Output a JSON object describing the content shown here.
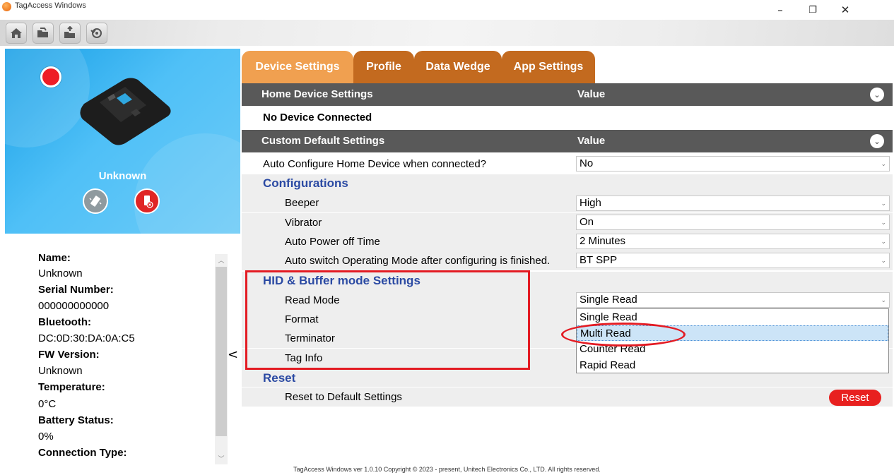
{
  "window": {
    "title": "TagAccess Windows",
    "minimize": "–",
    "restore": "❐",
    "close": "✕"
  },
  "toolbar": {
    "icons": [
      "home-icon",
      "open-folder-icon",
      "open-folder-arrow-icon",
      "refresh-icon"
    ]
  },
  "device": {
    "name": "Unknown",
    "status_color": "#ee1c25"
  },
  "info": {
    "name_label": "Name:",
    "name_value": "Unknown",
    "serial_label": "Serial Number:",
    "serial_value": "000000000000",
    "bt_label": "Bluetooth:",
    "bt_value": "DC:0D:30:DA:0A:C5",
    "fw_label": "FW Version:",
    "fw_value": "Unknown",
    "temp_label": "Temperature:",
    "temp_value": "0°C",
    "battery_label": "Battery Status:",
    "battery_value": "0%",
    "conn_label": "Connection Type:"
  },
  "collapse_arrow": "<",
  "tabs": [
    "Device Settings",
    "Profile",
    "Data Wedge",
    "App Settings"
  ],
  "home_header": {
    "label": "Home Device Settings",
    "value": "Value"
  },
  "no_device": "No Device Connected",
  "custom_header": {
    "label": "Custom Default Settings",
    "value": "Value"
  },
  "auto_configure": {
    "label": "Auto Configure Home Device when connected?",
    "value": "No"
  },
  "configurations": {
    "title": "Configurations",
    "beeper": {
      "label": "Beeper",
      "value": "High"
    },
    "vibrator": {
      "label": "Vibrator",
      "value": "On"
    },
    "power_off": {
      "label": "Auto Power off Time",
      "value": "2 Minutes"
    },
    "auto_switch": {
      "label": "Auto switch Operating Mode after configuring is finished.",
      "value": "BT SPP"
    }
  },
  "hid": {
    "title": "HID & Buffer mode Settings",
    "read_mode": {
      "label": "Read Mode",
      "value": "Single Read"
    },
    "format": "Format",
    "terminator": "Terminator",
    "tag_info": "Tag Info"
  },
  "dropdown_options": [
    "Single Read",
    "Multi Read",
    "Counter Read",
    "Rapid Read"
  ],
  "reset": {
    "title": "Reset",
    "label": "Reset to Default Settings",
    "button": "Reset"
  },
  "footer": "TagAccess Windows ver 1.0.10 Copyright © 2023 - present, Unitech Electronics Co., LTD. All rights reserved."
}
